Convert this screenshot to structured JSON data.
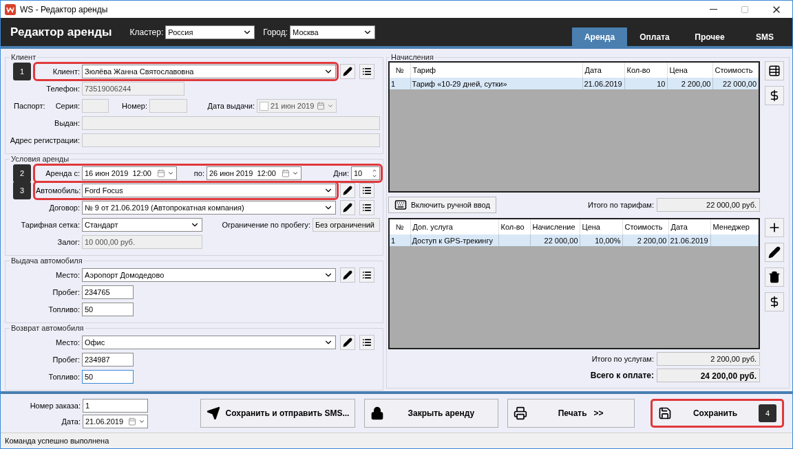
{
  "window": {
    "title": "WS - Редактор аренды"
  },
  "header": {
    "title": "Редактор аренды",
    "cluster": {
      "label": "Кластер:",
      "value": "Россия"
    },
    "city": {
      "label": "Город:",
      "value": "Москва"
    }
  },
  "tabs": [
    {
      "label": "Аренда",
      "selected": true
    },
    {
      "label": "Оплата",
      "selected": false
    },
    {
      "label": "Прочее",
      "selected": false
    },
    {
      "label": "SMS",
      "selected": false
    }
  ],
  "client": {
    "legend": "Клиент",
    "callout": "1",
    "client": {
      "label": "Клиент:",
      "value": "Зюлёва Жанна Святославовна"
    },
    "phone": {
      "label": "Телефон:",
      "value": "73519006244",
      "disabled": true
    },
    "passport_label": "Паспорт:",
    "series": {
      "label": "Серия:",
      "disabled": true
    },
    "number": {
      "label": "Номер:",
      "disabled": true
    },
    "issue_date": {
      "label": "Дата выдачи:",
      "value": "21 июн 2019",
      "checked": false,
      "disabled": true
    },
    "issued_by": {
      "label": "Выдан:",
      "disabled": true
    },
    "address": {
      "label": "Адрес регистрации:",
      "disabled": true
    }
  },
  "terms": {
    "legend": "Условия аренды",
    "callout": "2",
    "rent_from": {
      "label": "Аренда с:",
      "value": "16 июн 2019  12:00"
    },
    "rent_to": {
      "label": "по:",
      "value": "26 июн 2019  12:00"
    },
    "days": {
      "label": "Дни:",
      "value": "10"
    },
    "car": {
      "label": "Автомобиль:",
      "value": "Ford Focus",
      "callout": "3"
    },
    "contract": {
      "label": "Договор:",
      "value": "№ 9 от 21.06.2019 (Автопрокатная компания)"
    },
    "tariff_grid": {
      "label": "Тарифная сетка:",
      "value": "Стандарт"
    },
    "mileage_limit": {
      "label": "Ограничение по пробегу:",
      "value": "Без ограничений"
    },
    "deposit": {
      "label": "Залог:",
      "value": "10 000,00 руб.",
      "disabled": true
    }
  },
  "pickup": {
    "legend": "Выдача автомобиля",
    "place": {
      "label": "Место:",
      "value": "Аэропорт Домодедово"
    },
    "mileage": {
      "label": "Пробег:",
      "value": "234765",
      "focused": false
    },
    "fuel": {
      "label": "Топливо:",
      "value": "50",
      "focused": false
    }
  },
  "return": {
    "legend": "Возврат автомобиля",
    "place": {
      "label": "Место:",
      "value": "Офис"
    },
    "mileage": {
      "label": "Пробег:",
      "value": "234987",
      "focused": false
    },
    "fuel": {
      "label": "Топливо:",
      "value": "50",
      "focused": true
    }
  },
  "charges": {
    "legend": "Начисления",
    "columns": [
      {
        "label": "№",
        "kind": "text"
      },
      {
        "label": "Тариф",
        "kind": "text"
      },
      {
        "label": "Дата",
        "kind": "text"
      },
      {
        "label": "Кол-во",
        "kind": "number"
      },
      {
        "label": "Цена",
        "kind": "number"
      },
      {
        "label": "Стоимость",
        "kind": "number"
      }
    ],
    "rows": [
      {
        "selected": true,
        "cells": [
          "1",
          "Тариф «10-29 дней, сутки»",
          "21.06.2019",
          "10",
          "2 200,00",
          "22 000,00"
        ]
      }
    ],
    "manual_button": "Включить ручной ввод",
    "total": {
      "label": "Итого по тарифам:",
      "value": "22 000,00 руб."
    }
  },
  "services": {
    "columns": [
      {
        "label": "№",
        "kind": "text"
      },
      {
        "label": "Доп. услуга",
        "kind": "text"
      },
      {
        "label": "Кол-во",
        "kind": "number"
      },
      {
        "label": "Начисление",
        "kind": "number"
      },
      {
        "label": "Цена",
        "kind": "number"
      },
      {
        "label": "Стоимость",
        "kind": "number"
      },
      {
        "label": "Дата",
        "kind": "text"
      },
      {
        "label": "Менеджер",
        "kind": "text"
      }
    ],
    "rows": [
      {
        "selected": true,
        "cells": [
          "1",
          "Доступ к GPS-трекингу",
          "",
          "22 000,00",
          "10,00%",
          "2 200,00",
          "21.06.2019",
          ""
        ]
      }
    ],
    "total": {
      "label": "Итого по услугам:",
      "value": "2 200,00 руб."
    },
    "grand_total": {
      "label": "Всего к оплате:",
      "value": "24 200,00 руб."
    }
  },
  "order": {
    "number": {
      "label": "Номер заказа:",
      "value": "1"
    },
    "date": {
      "label": "Дата:",
      "value": "21.06.2019"
    }
  },
  "buttons": [
    {
      "label": "Сохранить и отправить SMS...",
      "kind": "send"
    },
    {
      "label": "Закрыть аренду",
      "kind": "lock"
    },
    {
      "label": "Печать   >>",
      "kind": "print"
    },
    {
      "label": "Сохранить",
      "kind": "save",
      "callout": "4"
    }
  ],
  "status_bar": "Команда успешно выполнена"
}
